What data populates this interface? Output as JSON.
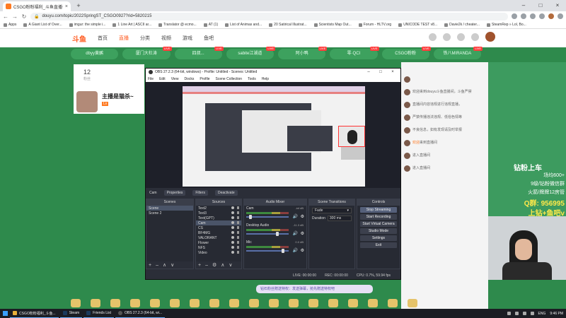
{
  "browser": {
    "tab_title": "CSGO粉粉福利_斗鱼直播平台",
    "url": "douyu.com/topic/2022SpringST_CSGO0927?rid=5820215",
    "bookmarks": [
      "Apps",
      "A Giant List of Over...",
      "imgur: the simple i...",
      "1 Line Art | ASCII ar...",
      "Translator @ ecmo...",
      "AT (1)",
      "List of Animas and...",
      "20 Satirical Illustrat...",
      "Scientists Map Out...",
      "Forum - HLTV.org",
      "UNICODE TEST v8...",
      "Davie2k / cheater...",
      "SteamRep » Lol, Bo..."
    ]
  },
  "douyu": {
    "logo": "斗鱼",
    "nav": [
      "首页",
      "直播",
      "分类",
      "视频",
      "游戏",
      "鱼吧"
    ],
    "game_tabs": [
      "dbyy黄鹂",
      "厦门大杜涛",
      "四叔...",
      "sabite江湖道",
      "阿小鸭",
      "零·QCI",
      "CSGO粉粉",
      "铁八MIRANDA"
    ],
    "fans_count": "12",
    "fans_label": "粉丝",
    "host_name": "主播是猫杀~",
    "host_badge": "Lv",
    "chat": [
      {
        "user": "",
        "text": ""
      },
      {
        "user": "",
        "text": "欢迎来到douyu斗鱼直播间，斗鱼严禁"
      },
      {
        "user": "",
        "text": "直播间内容违规进行违规直播，"
      },
      {
        "user": "",
        "text": "严禁传播违法违规、低俗色情等"
      },
      {
        "user": "",
        "text": "不良信息，如有发现请及时举报"
      },
      {
        "user": "欢迎",
        "text": "来到直播间"
      },
      {
        "user": "",
        "text": "进入直播间"
      },
      {
        "user": "",
        "text": "进入直播间"
      }
    ],
    "ad": {
      "title": "钻粉上车",
      "lines": [
        "场均600+",
        "9级/钻粉微信群",
        "火箭/牌牌12房管",
        "Q群: 956995",
        "上钻+鱼吧v"
      ]
    },
    "danmu_placeholder": "钻石粉丝赠送特权：发送弹幕，抢先赠送特权吧"
  },
  "obs": {
    "title": "OBS 27.2.3 (64-bit, windows) - Profile: Untitled - Scenes: Untitled",
    "menu": [
      "File",
      "Edit",
      "View",
      "Docks",
      "Profile",
      "Scene Collection",
      "Tools",
      "Help"
    ],
    "source_name": "Cam",
    "properties_label": "Properties",
    "filters_label": "Filters",
    "deactivate_label": "Deactivate",
    "docks": {
      "scenes": {
        "title": "Scenes",
        "items": [
          "Scene",
          "Scene 2"
        ]
      },
      "sources": {
        "title": "Sources",
        "items": [
          "Text2",
          "Text3",
          "Text(GPT)",
          "Cam",
          "CS",
          "BF4MG",
          "VALORANT",
          "Flower",
          "NFS",
          "Video"
        ]
      },
      "mixer": {
        "title": "Audio Mixer",
        "tracks": [
          {
            "name": "Cam",
            "db": "-inf dB",
            "volume": 0.08
          },
          {
            "name": "Desktop Audio",
            "db": "-11.3 dB",
            "volume": 0.75
          },
          {
            "name": "Mic",
            "db": "0.0 dB",
            "volume": 0.9
          }
        ]
      },
      "transitions": {
        "title": "Scene Transitions",
        "type": "Fade",
        "duration_label": "Duration",
        "duration_value": "300 ms"
      },
      "controls": {
        "title": "Controls",
        "buttons": [
          "Stop Streaming",
          "Start Recording",
          "Start Virtual Camera",
          "Studio Mode",
          "Settings",
          "Exit"
        ]
      }
    },
    "status": {
      "live": "LIVE: 00:00:00",
      "rec": "REC: 00:00:00",
      "cpu": "CPU: 0.7%, 59.94 fps"
    }
  },
  "taskbar": {
    "apps": [
      "CSGO粉粉福利_斗鱼...",
      "Steam",
      "Friends List",
      "OBS 27.2.3 (64-bit, wi..."
    ],
    "lang": "ENG",
    "time": "9:46 PM"
  },
  "colors": {
    "douyu_accent": "#ff5d23",
    "page_bg": "#2e8a4c",
    "obs_bg": "#2b2e38"
  }
}
